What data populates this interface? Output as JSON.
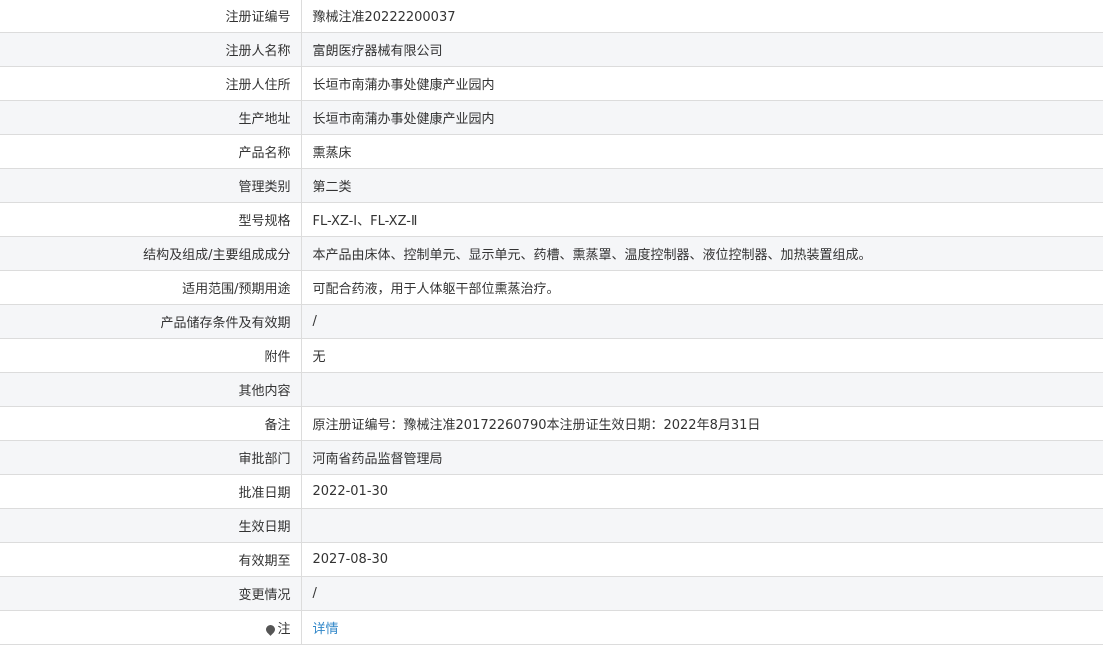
{
  "rows": [
    {
      "label": "注册证编号",
      "value": "豫械注准20222200037"
    },
    {
      "label": "注册人名称",
      "value": "富朗医疗器械有限公司"
    },
    {
      "label": "注册人住所",
      "value": "长垣市南蒲办事处健康产业园内"
    },
    {
      "label": "生产地址",
      "value": "长垣市南蒲办事处健康产业园内"
    },
    {
      "label": "产品名称",
      "value": "熏蒸床"
    },
    {
      "label": "管理类别",
      "value": "第二类"
    },
    {
      "label": "型号规格",
      "value": "FL-XZ-Ⅰ、FL-XZ-Ⅱ"
    },
    {
      "label": "结构及组成/主要组成成分",
      "value": "本产品由床体、控制单元、显示单元、药槽、熏蒸罩、温度控制器、液位控制器、加热装置组成。"
    },
    {
      "label": "适用范围/预期用途",
      "value": "可配合药液，用于人体躯干部位熏蒸治疗。"
    },
    {
      "label": "产品储存条件及有效期",
      "value": "/"
    },
    {
      "label": "附件",
      "value": "无"
    },
    {
      "label": "其他内容",
      "value": ""
    },
    {
      "label": "备注",
      "value": "原注册证编号：豫械注准20172260790本注册证生效日期：2022年8月31日"
    },
    {
      "label": "审批部门",
      "value": "河南省药品监督管理局"
    },
    {
      "label": "批准日期",
      "value": "2022-01-30"
    },
    {
      "label": "生效日期",
      "value": ""
    },
    {
      "label": "有效期至",
      "value": "2027-08-30"
    },
    {
      "label": "变更情况",
      "value": "/"
    }
  ],
  "note_row": {
    "label": "注",
    "icon": "pin-icon",
    "link_text": "详情"
  }
}
